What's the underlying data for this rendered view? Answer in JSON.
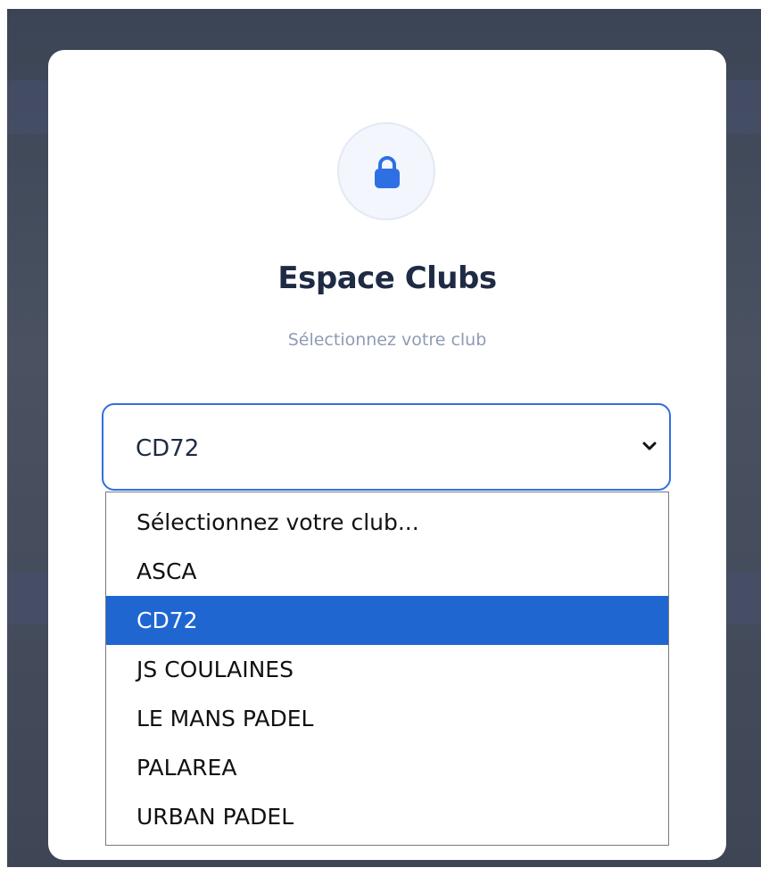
{
  "dialog": {
    "title": "Espace Clubs",
    "subtitle": "Sélectionnez votre club",
    "icon": "lock-icon"
  },
  "club_select": {
    "value": "CD72",
    "options": [
      {
        "label": "Sélectionnez votre club...",
        "selected": false
      },
      {
        "label": "ASCA",
        "selected": false
      },
      {
        "label": "CD72",
        "selected": true
      },
      {
        "label": "JS COULAINES",
        "selected": false
      },
      {
        "label": "LE MANS PADEL",
        "selected": false
      },
      {
        "label": "PALAREA",
        "selected": false
      },
      {
        "label": "URBAN PADEL",
        "selected": false
      }
    ]
  },
  "colors": {
    "accent": "#2f6fe4",
    "selected_option": "#1f66d1",
    "title": "#1f2a44",
    "subtitle": "#8f9bb3"
  }
}
